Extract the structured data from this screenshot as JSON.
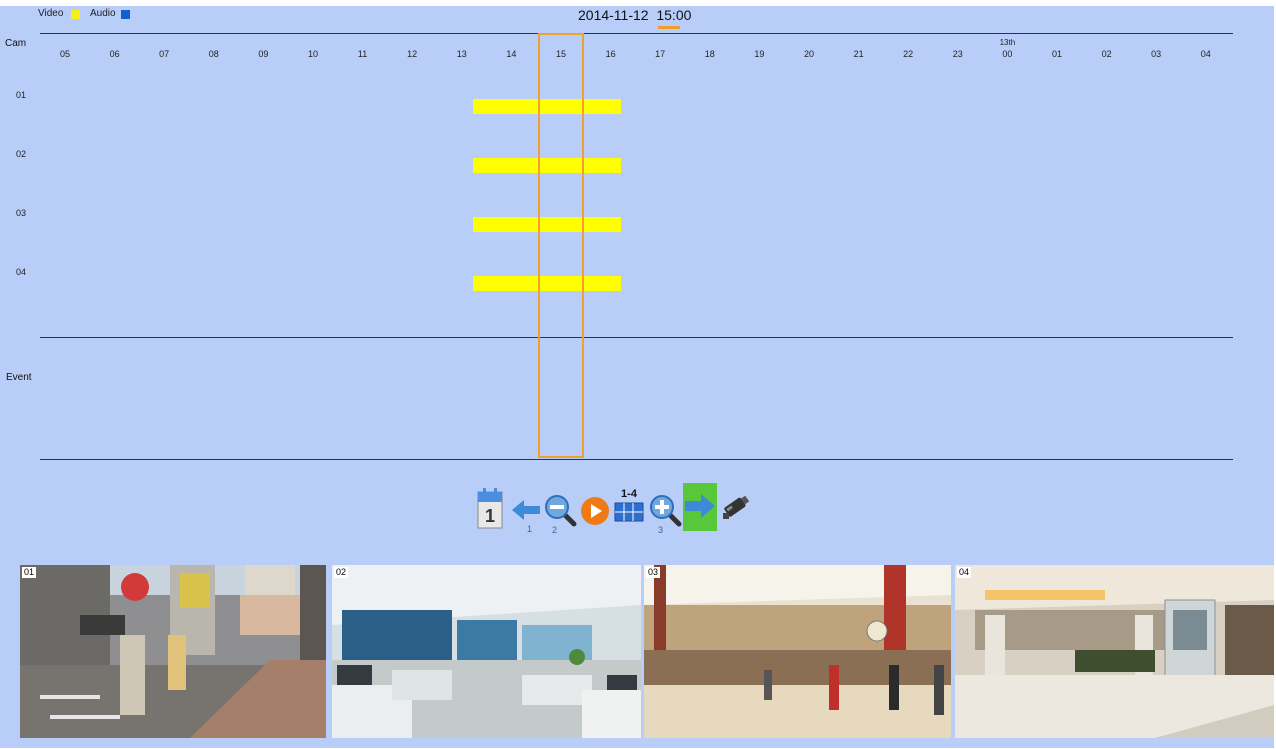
{
  "legend": [
    {
      "label": "Video",
      "color": "#f6ef1c"
    },
    {
      "label": "Audio",
      "color": "#1060d0"
    }
  ],
  "header": {
    "date": "2014-11-12",
    "time": "15:00"
  },
  "timeline": {
    "cam_header": "Cam",
    "event_label": "Event",
    "day_marker": "13th",
    "hours": [
      "05",
      "06",
      "07",
      "08",
      "09",
      "10",
      "11",
      "12",
      "13",
      "14",
      "15",
      "16",
      "17",
      "18",
      "19",
      "20",
      "21",
      "22",
      "23",
      "00",
      "01",
      "02",
      "03",
      "04"
    ],
    "cameras": [
      "01",
      "02",
      "03",
      "04"
    ],
    "recordings": [
      {
        "camera": "01",
        "type": "video",
        "from_hour": 13.5,
        "to_hour": 16.5
      },
      {
        "camera": "02",
        "type": "video",
        "from_hour": 13.5,
        "to_hour": 16.5
      },
      {
        "camera": "03",
        "type": "video",
        "from_hour": 13.5,
        "to_hour": 16.5
      },
      {
        "camera": "04",
        "type": "video",
        "from_hour": 13.5,
        "to_hour": 16.5
      }
    ],
    "selected_hour": "15",
    "record_color": "#ffff00",
    "cursor_color": "#f0a030"
  },
  "toolbar": {
    "calendar": {
      "icon": "calendar-icon",
      "label": "1"
    },
    "back": {
      "icon": "arrow-left-icon",
      "label": "1"
    },
    "zoom_out": {
      "icon": "zoom-out-icon",
      "label": "2"
    },
    "play": {
      "icon": "play-icon"
    },
    "layout": {
      "icon": "grid-layout-icon",
      "label": "1-4"
    },
    "zoom_in": {
      "icon": "zoom-in-icon",
      "label": "3"
    },
    "forward": {
      "icon": "arrow-right-icon"
    },
    "camera": {
      "icon": "camera-icon"
    }
  },
  "thumbnails": [
    {
      "label": "01",
      "scene": "street"
    },
    {
      "label": "02",
      "scene": "office"
    },
    {
      "label": "03",
      "scene": "mall-atrium"
    },
    {
      "label": "04",
      "scene": "mall-lobby"
    }
  ]
}
